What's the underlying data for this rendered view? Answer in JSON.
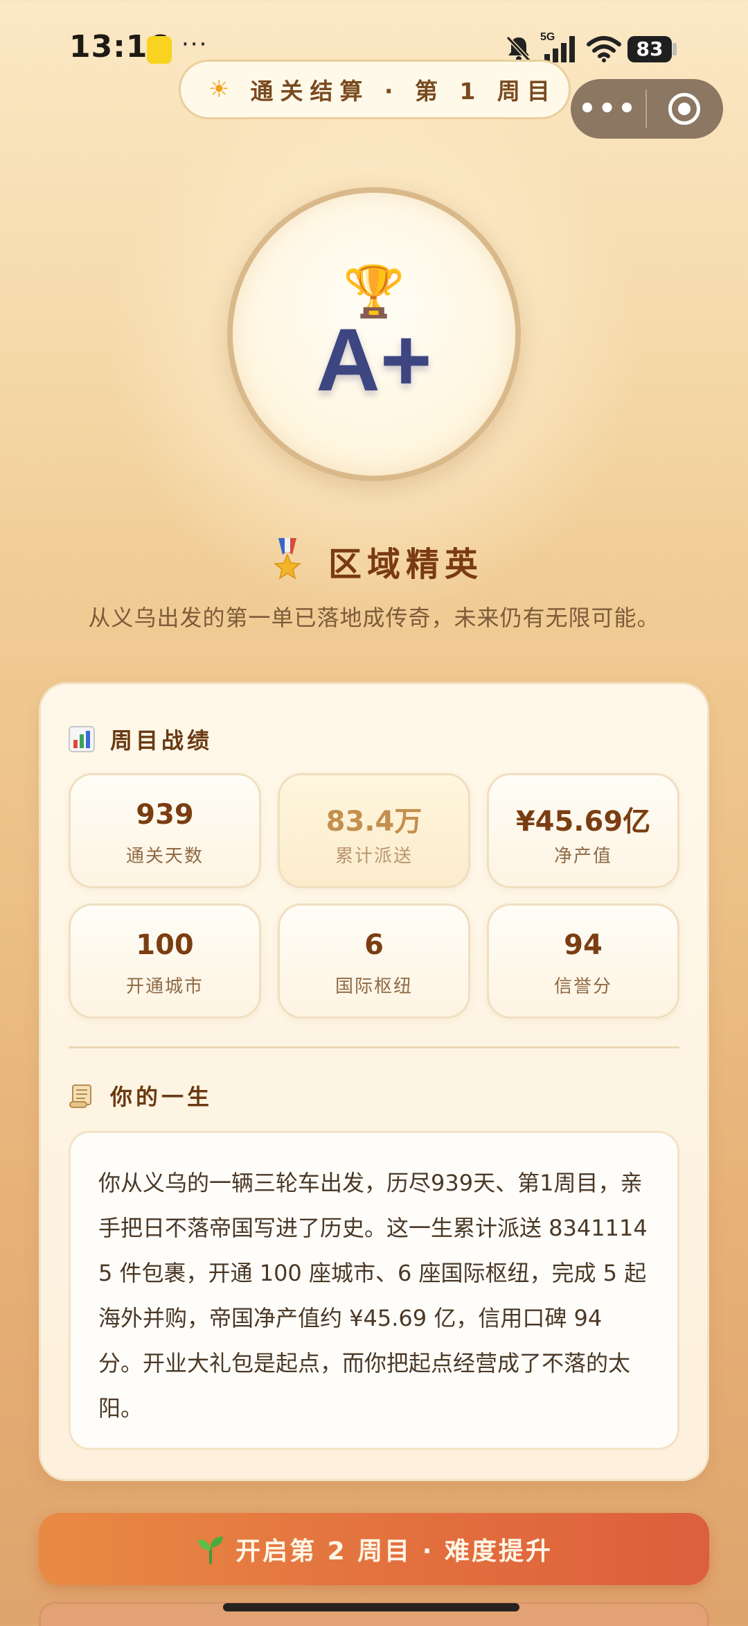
{
  "status_bar": {
    "time": "13:16",
    "dots": "···",
    "network": "5G",
    "battery": "83"
  },
  "header": {
    "title": "通关结算 · 第 1 周目",
    "sun_icon": "sun-icon",
    "more_icon": "more-dots-icon",
    "close_icon": "target-circle-icon"
  },
  "grade": {
    "trophy_icon": "trophy-icon",
    "value": "A+"
  },
  "rank": {
    "medal_icon": "medal-icon",
    "title": "区域精英",
    "subtitle": "从义乌出发的第一单已落地成传奇，未来仍有无限可能。"
  },
  "stats_section": {
    "icon": "bar-chart-icon",
    "title": "周目战绩",
    "items": [
      {
        "value": "939",
        "label": "通关天数"
      },
      {
        "value": "83.4万",
        "label": "累计派送"
      },
      {
        "value": "¥45.69亿",
        "label": "净产值"
      },
      {
        "value": "100",
        "label": "开通城市"
      },
      {
        "value": "6",
        "label": "国际枢纽"
      },
      {
        "value": "94",
        "label": "信誉分"
      }
    ]
  },
  "life_section": {
    "icon": "scroll-icon",
    "title": "你的一生",
    "story": "你从义乌的一辆三轮车出发，历尽939天、第1周目，亲手把日不落帝国写进了历史。这一生累计派送 83411145 件包裹，开通 100 座城市、6 座国际枢纽，完成 5 起海外并购，帝国净产值约 ¥45.69 亿，信用口碑 94 分。开业大礼包是起点，而你把起点经营成了不落的太阳。"
  },
  "next_button": {
    "icon": "sprout-icon",
    "label": "开启第 2 周目 · 难度提升"
  },
  "colors": {
    "accent": "#e3703e",
    "grade": "#3d4681",
    "title": "#7a3a12"
  }
}
